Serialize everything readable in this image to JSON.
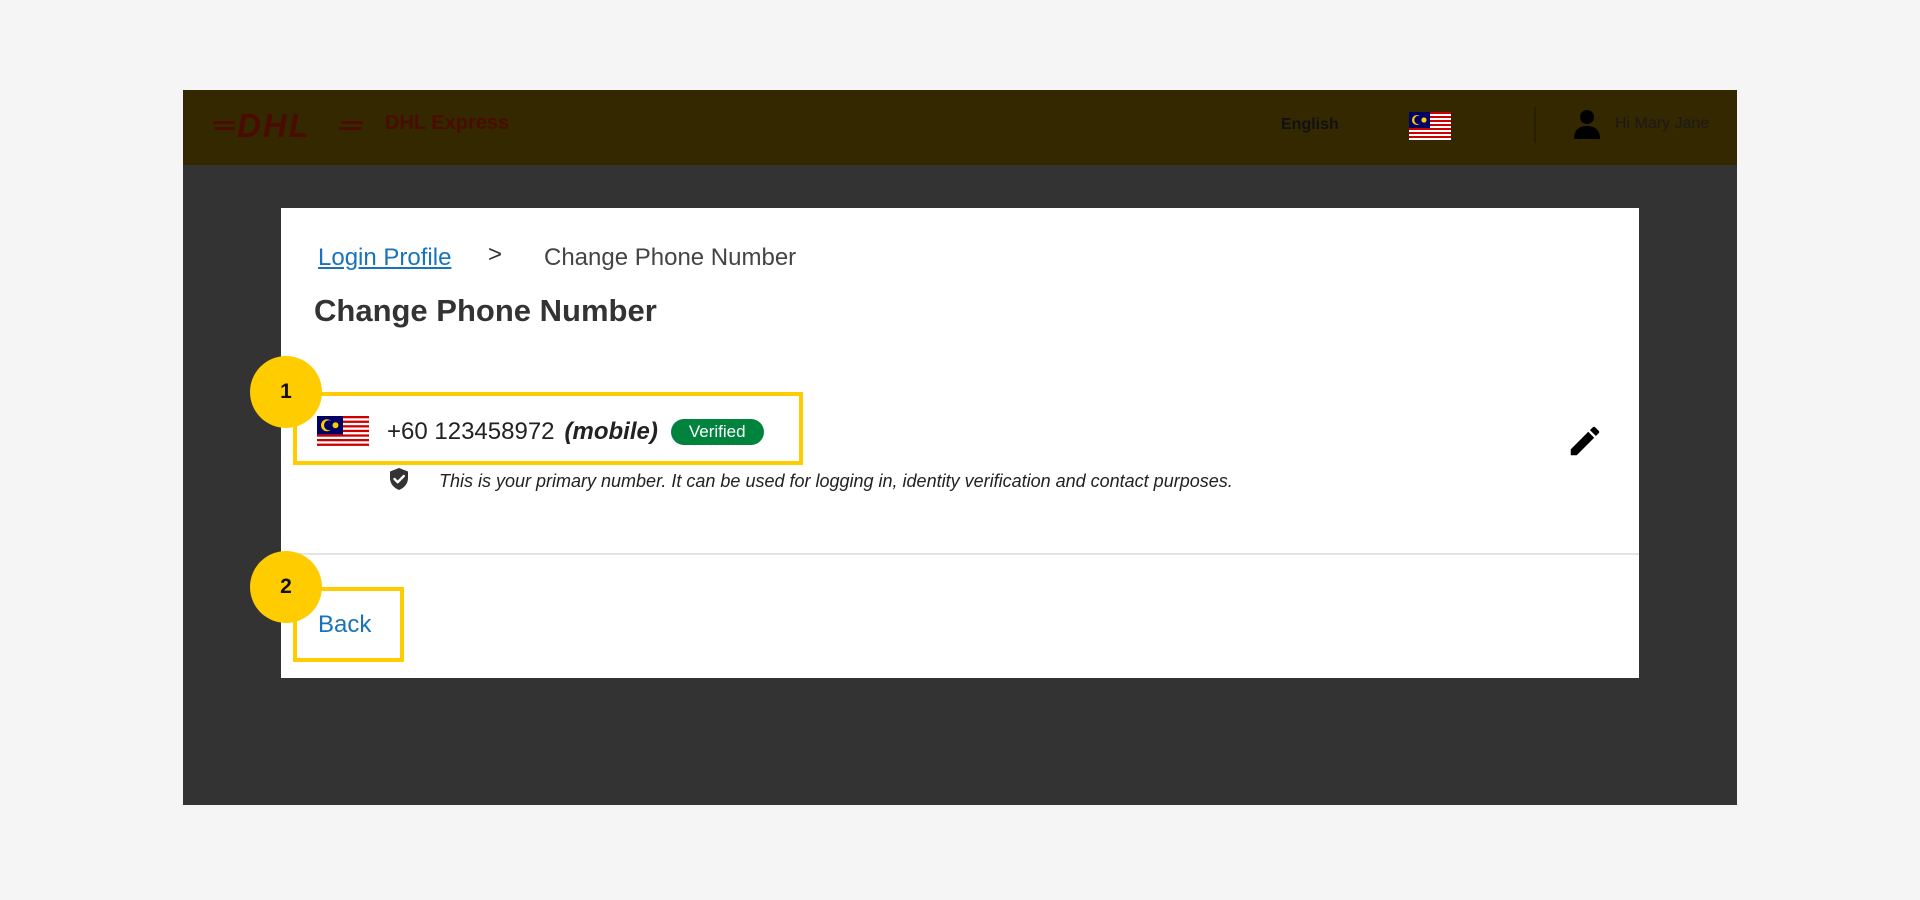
{
  "header": {
    "logo_text": "DHL",
    "brand": "DHL Express",
    "language": "English",
    "country_flag_icon": "malaysia-flag-icon",
    "user_icon": "user-icon",
    "greeting": "Hi Mary Jane",
    "bar_color": "#332800",
    "logo_color": "#4a0c00"
  },
  "breadcrumb": {
    "parent": "Login Profile",
    "separator": ">",
    "current": "Change Phone Number"
  },
  "page": {
    "title": "Change Phone Number"
  },
  "phone": {
    "flag_icon": "malaysia-flag-icon",
    "number": "+60 123458972",
    "type": "(mobile)",
    "status": "Verified",
    "status_color": "#00843d",
    "note_icon": "shield-check-icon",
    "note": "This is your primary number. It can be used for logging in, identity verification and contact purposes.",
    "edit_icon": "pencil-icon"
  },
  "actions": {
    "back": "Back"
  },
  "annotations": [
    {
      "label": "1",
      "color": "#ffcc00"
    },
    {
      "label": "2",
      "color": "#ffcc00"
    }
  ]
}
